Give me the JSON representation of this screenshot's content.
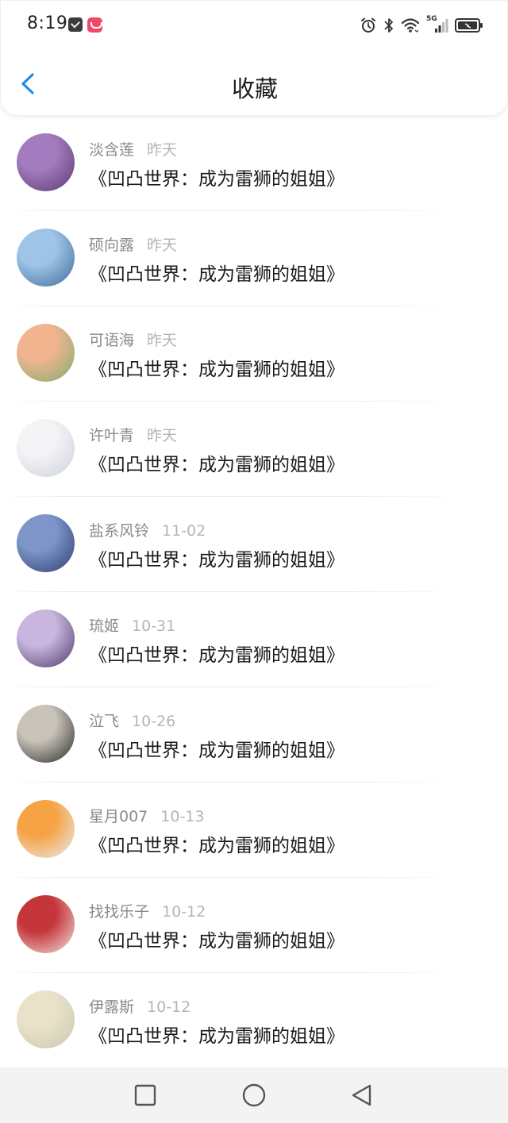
{
  "status_bar": {
    "time": "8:19",
    "icons": [
      "message-icon",
      "app-icon",
      "alarm-icon",
      "bluetooth-icon",
      "wifi-icon",
      "5g-signal-icon",
      "battery-icon"
    ],
    "network_label": "5G"
  },
  "header": {
    "title": "收藏",
    "back_icon": "chevron-left-icon",
    "accent_color": "#1f8ceb"
  },
  "favorites": [
    {
      "user": "淡含莲",
      "date": "昨天",
      "title": "《凹凸世界：成为雷狮的姐姐》",
      "avatar_colors": [
        "#a37cc0",
        "#5b3b6f"
      ]
    },
    {
      "user": "硕向露",
      "date": "昨天",
      "title": "《凹凸世界：成为雷狮的姐姐》",
      "avatar_colors": [
        "#9fc4e6",
        "#3e6b9a"
      ]
    },
    {
      "user": "可语海",
      "date": "昨天",
      "title": "《凹凸世界：成为雷狮的姐姐》",
      "avatar_colors": [
        "#f1b48f",
        "#7fae6e"
      ]
    },
    {
      "user": "许叶青",
      "date": "昨天",
      "title": "《凹凸世界：成为雷狮的姐姐》",
      "avatar_colors": [
        "#f4f4f6",
        "#cdd0dc"
      ]
    },
    {
      "user": "盐系风铃",
      "date": "11-02",
      "title": "《凹凸世界：成为雷狮的姐姐》",
      "avatar_colors": [
        "#7d95c9",
        "#2f3f6e"
      ]
    },
    {
      "user": "琉姬",
      "date": "10-31",
      "title": "《凹凸世界：成为雷狮的姐姐》",
      "avatar_colors": [
        "#c9b6de",
        "#4c3a6a"
      ]
    },
    {
      "user": "泣飞",
      "date": "10-26",
      "title": "《凹凸世界：成为雷狮的姐姐》",
      "avatar_colors": [
        "#c8c2b8",
        "#2b2b2b"
      ]
    },
    {
      "user": "星月007",
      "date": "10-13",
      "title": "《凹凸世界：成为雷狮的姐姐》",
      "avatar_colors": [
        "#f6a345",
        "#e8eef6"
      ]
    },
    {
      "user": "找找乐子",
      "date": "10-12",
      "title": "《凹凸世界：成为雷狮的姐姐》",
      "avatar_colors": [
        "#c4363a",
        "#f3e4df"
      ]
    },
    {
      "user": "伊露斯",
      "date": "10-12",
      "title": "《凹凸世界：成为雷狮的姐姐》",
      "avatar_colors": [
        "#e9e2c9",
        "#c7c9b1"
      ]
    }
  ],
  "nav_bar": {
    "buttons": [
      "recent-apps-icon",
      "home-icon",
      "back-triangle-icon"
    ]
  }
}
